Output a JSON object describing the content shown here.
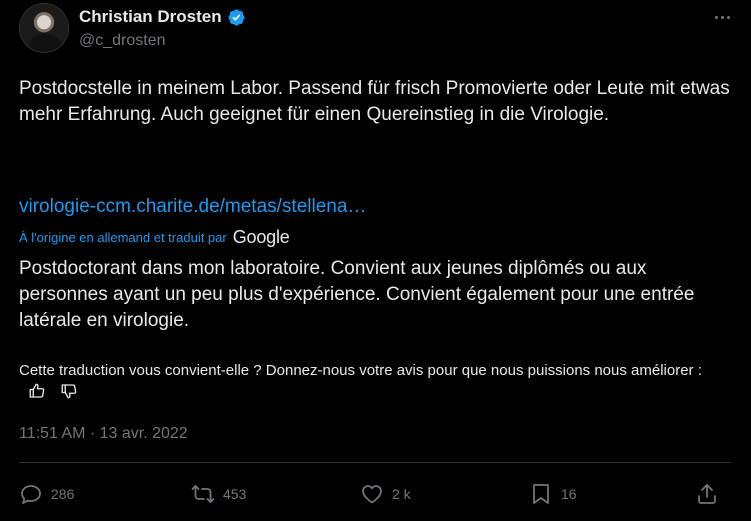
{
  "author": {
    "name": "Christian Drosten",
    "handle": "@c_drosten"
  },
  "tweet": {
    "text": "Postdocstelle in meinem Labor. Passend für frisch Promovierte oder Leute mit etwas mehr Erfahrung. Auch geeignet für einen Quereinstieg in die Virologie.",
    "link": "virologie-ccm.charite.de/metas/stellena…",
    "translated_by_label": "À l'origine en allemand et traduit par",
    "translator": "Google",
    "translation": "Postdoctorant dans mon laboratoire. Convient aux jeunes diplômés ou aux personnes ayant un peu plus d'expérience. Convient également pour une entrée latérale en virologie.",
    "feedback_prompt": "Cette traduction vous convient-elle ? Donnez-nous votre avis pour que nous puissions nous améliorer :",
    "timestamp": "11:51 AM · 13 avr. 2022"
  },
  "actions": {
    "replies": "286",
    "reposts": "453",
    "likes": "2 k",
    "bookmarks": "16"
  },
  "colors": {
    "accent": "#1d9bf0",
    "background": "#000000",
    "muted": "#71767b"
  },
  "icons": [
    "verified-badge-icon",
    "more-icon",
    "thumbs-up-icon",
    "thumbs-down-icon",
    "reply-icon",
    "repost-icon",
    "like-icon",
    "bookmark-icon",
    "share-icon"
  ]
}
